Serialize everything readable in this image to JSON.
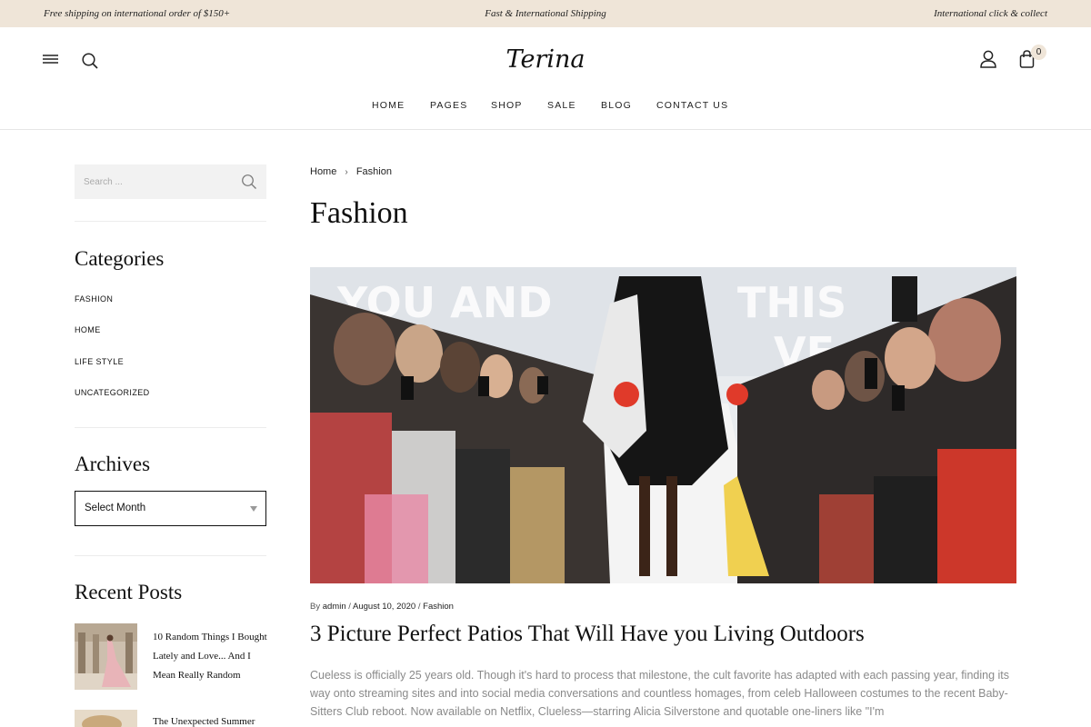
{
  "topbar": {
    "left": "Free shipping on international order of $150+",
    "center": "Fast & International Shipping",
    "right": "International click & collect"
  },
  "header": {
    "logo_text": "Terina",
    "cart_count": "0",
    "nav": [
      "HOME",
      "PAGES",
      "SHOP",
      "SALE",
      "BLOG",
      "CONTACT US"
    ]
  },
  "sidebar": {
    "search_placeholder": "Search ...",
    "categories_title": "Categories",
    "categories": [
      "FASHION",
      "HOME",
      "LIFE STYLE",
      "UNCATEGORIZED"
    ],
    "archives_title": "Archives",
    "archives_selected": "Select Month",
    "recent_title": "Recent Posts",
    "recent_posts": [
      "10 Random Things I Bought Lately and Love... And I Mean Really Random",
      "The Unexpected Summer"
    ]
  },
  "main": {
    "breadcrumb_home": "Home",
    "breadcrumb_current": "Fashion",
    "page_title": "Fashion",
    "hero_banner_text_1": "YOU AND",
    "hero_banner_text_2": "THIS",
    "hero_banner_text_3": "VE",
    "meta_by": "By",
    "meta_author": "admin",
    "meta_sep": "/",
    "meta_date": "August 10, 2020",
    "meta_category": "Fashion",
    "post_title": "3 Picture Perfect Patios That Will Have you Living Outdoors",
    "excerpt": "Cueless is officially 25 years old. Though it's hard to process that milestone, the cult favorite has adapted with each passing year, finding its way onto streaming sites and into social media conversations and countless homages, from celeb Halloween costumes to the recent Baby-Sitters Club reboot. Now available on Netflix, Clueless—starring Alicia Silverstone and quotable one-liners like \"I'm"
  },
  "colors": {
    "topbar_bg": "#efe5d8",
    "text": "#111111",
    "muted": "#8a8a8a",
    "search_bg": "#f2f2f2"
  },
  "icons": [
    "menu-icon",
    "search-icon",
    "user-icon",
    "shopping-bag-icon",
    "chevron-right-icon",
    "chevron-down-icon"
  ]
}
